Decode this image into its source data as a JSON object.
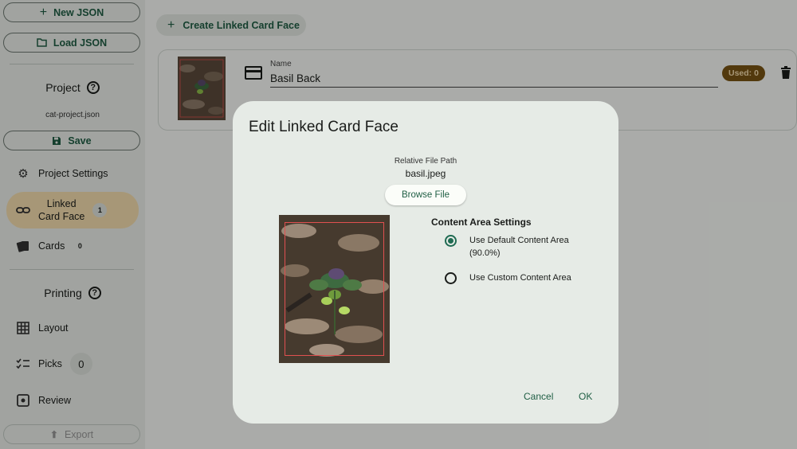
{
  "sidebar": {
    "new_json": "New JSON",
    "load_json": "Load JSON",
    "project_title": "Project",
    "project_file": "cat-project.json",
    "save": "Save",
    "project_settings": "Project Settings",
    "linked_card_face_line1": "Linked",
    "linked_card_face_line2": "Card Face",
    "linked_card_face_count": "1",
    "cards": "Cards",
    "cards_count": "0",
    "printing_title": "Printing",
    "layout": "Layout",
    "picks": "Picks",
    "picks_count": "0",
    "review": "Review",
    "export": "Export"
  },
  "main": {
    "create_button": "Create Linked Card Face",
    "card": {
      "name_label": "Name",
      "name_value": "Basil Back",
      "used_badge": "Used: 0"
    }
  },
  "dialog": {
    "title": "Edit Linked Card Face",
    "relative_path_label": "Relative File Path",
    "relative_path_value": "basil.jpeg",
    "browse_button": "Browse File",
    "content_area_title": "Content Area Settings",
    "option_default_line1": "Use Default Content Area",
    "option_default_line2": "(90.0%)",
    "option_custom": "Use Custom Content Area",
    "selected_option": "default",
    "cancel": "Cancel",
    "ok": "OK"
  },
  "colors": {
    "accent": "#1f5e44",
    "active_nav": "#f7dfb0",
    "used_badge": "#7a5414"
  }
}
